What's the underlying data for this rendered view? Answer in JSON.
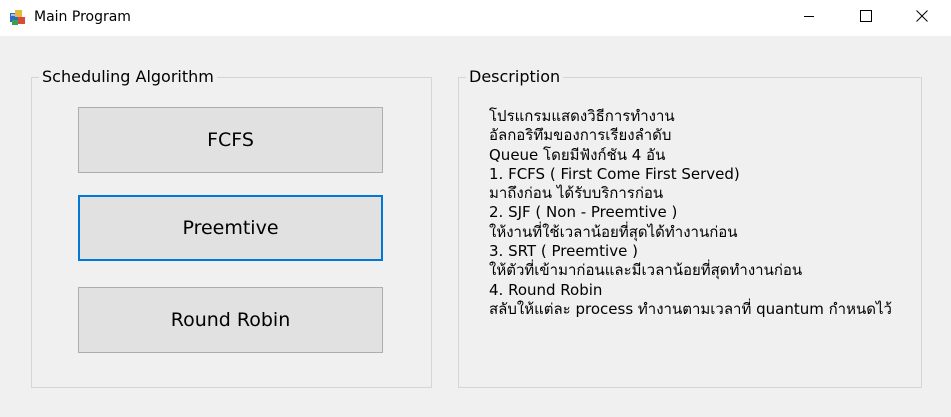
{
  "window": {
    "title": "Main Program",
    "icon": "windows-forms-app-icon",
    "controls": [
      "minimize-icon",
      "maximize-icon",
      "close-icon"
    ]
  },
  "scheduling": {
    "group_label": "Scheduling Algorithm",
    "buttons": [
      {
        "label": "FCFS",
        "focused": false
      },
      {
        "label": "Preemtive",
        "focused": true
      },
      {
        "label": "Round Robin",
        "focused": false
      }
    ]
  },
  "description": {
    "group_label": "Description",
    "lines": [
      "โปรแกรมแสดงวิธีการทำงาน",
      "อัลกอริทึมของการเรียงลำดับ",
      "Queue โดยมีฟังก์ชัน 4 อัน",
      "1. FCFS ( First Come First Served)",
      "มาถึงก่อน ได้รับบริการก่อน",
      "2. SJF ( Non - Preemtive )",
      "ให้งานที่ใช้เวลาน้อยที่สุดได้ทำงานก่อน",
      "3. SRT ( Preemtive )",
      "ให้ตัวที่เข้ามาก่อนและมีเวลาน้อยที่สุดทำงานก่อน",
      "4. Round Robin",
      "สลับให้แต่ละ process ทำงานตามเวลาที่ quantum กำหนดไว้"
    ]
  },
  "colors": {
    "window_bg": "#f0f0f0",
    "titlebar_bg": "#ffffff",
    "button_bg": "#e1e1e1",
    "button_border": "#adadad",
    "focus_border": "#0078d7",
    "group_border": "#d5d5d5"
  }
}
